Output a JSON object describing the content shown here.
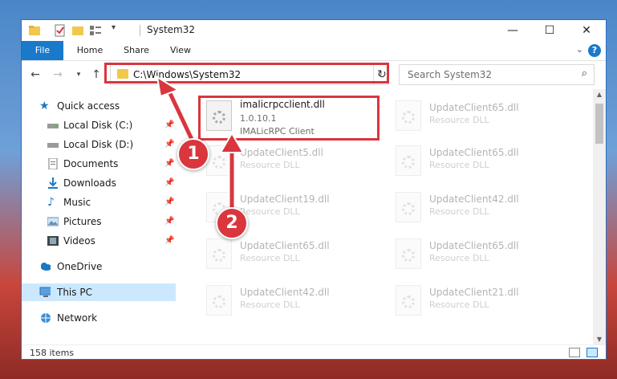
{
  "window": {
    "title": "System32"
  },
  "tabs": [
    {
      "label": "File"
    },
    {
      "label": "Home"
    },
    {
      "label": "Share"
    },
    {
      "label": "View"
    }
  ],
  "address": {
    "path": "C:\\Windows\\System32"
  },
  "search": {
    "placeholder": "Search System32"
  },
  "nav": {
    "quick_access": "Quick access",
    "items": [
      {
        "label": "Local Disk (C:)",
        "icon": "drive-icon"
      },
      {
        "label": "Local Disk (D:)",
        "icon": "drive-icon"
      },
      {
        "label": "Documents",
        "icon": "documents-icon"
      },
      {
        "label": "Downloads",
        "icon": "downloads-icon"
      },
      {
        "label": "Music",
        "icon": "music-icon"
      },
      {
        "label": "Pictures",
        "icon": "pictures-icon"
      },
      {
        "label": "Videos",
        "icon": "videos-icon"
      }
    ],
    "onedrive": "OneDrive",
    "thispc": "This PC",
    "network": "Network"
  },
  "files": {
    "main": {
      "name": "imalicrpcclient.dll",
      "version": "1.0.10.1",
      "desc": "IMALicRPC Client"
    },
    "faded": [
      {
        "name": "UpdateClient65.dll",
        "desc": "Resource DLL"
      },
      {
        "name": "UpdateClient5.dll",
        "desc": "Resource DLL"
      },
      {
        "name": "UpdateClient65.dll",
        "desc": "Resource DLL"
      },
      {
        "name": "UpdateClient19.dll",
        "desc": "Resource DLL"
      },
      {
        "name": "UpdateClient42.dll",
        "desc": "Resource DLL"
      },
      {
        "name": "UpdateClient65.dll",
        "desc": "Resource DLL"
      },
      {
        "name": "UpdateClient65.dll",
        "desc": "Resource DLL"
      },
      {
        "name": "UpdateClient42.dll",
        "desc": "Resource DLL"
      },
      {
        "name": "UpdateClient21.dll",
        "desc": "Resource DLL"
      }
    ]
  },
  "status": {
    "items": "158 items"
  },
  "annotations": [
    {
      "number": "1"
    },
    {
      "number": "2"
    }
  ],
  "colors": {
    "accent": "#1979ca",
    "highlight": "#d9363e",
    "selection": "#cce8ff"
  }
}
